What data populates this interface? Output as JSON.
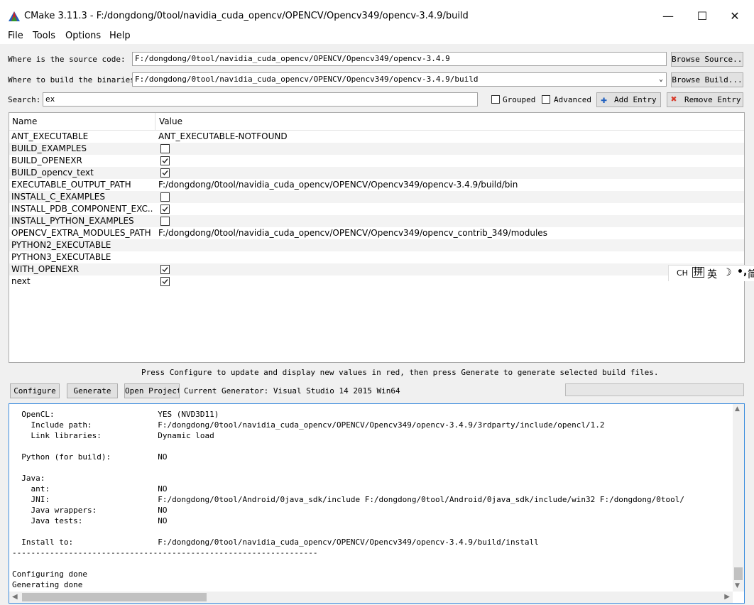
{
  "window": {
    "title": "CMake 3.11.3 - F:/dongdong/0tool/navidia_cuda_opencv/OPENCV/Opencv349/opencv-3.4.9/build",
    "minimize": "—",
    "maximize": "☐",
    "close": "✕"
  },
  "menu": [
    "File",
    "Tools",
    "Options",
    "Help"
  ],
  "source": {
    "label": "Where is the source code:",
    "value": "F:/dongdong/0tool/navidia_cuda_opencv/OPENCV/Opencv349/opencv-3.4.9",
    "button": "Browse Source..."
  },
  "binaries": {
    "label": "Where to build the binaries:",
    "value": "F:/dongdong/0tool/navidia_cuda_opencv/OPENCV/Opencv349/opencv-3.4.9/build",
    "button": "Browse Build..."
  },
  "search": {
    "label": "Search:",
    "value": "ex",
    "grouped": "Grouped",
    "advanced": "Advanced",
    "add_entry": "Add Entry",
    "remove_entry": "Remove Entry"
  },
  "table": {
    "headers": [
      "Name",
      "Value"
    ],
    "rows": [
      {
        "name": "ANT_EXECUTABLE",
        "value": "ANT_EXECUTABLE-NOTFOUND"
      },
      {
        "name": "BUILD_EXAMPLES",
        "checked": false
      },
      {
        "name": "BUILD_OPENEXR",
        "checked": true
      },
      {
        "name": "BUILD_opencv_text",
        "checked": true
      },
      {
        "name": "EXECUTABLE_OUTPUT_PATH",
        "value": "F:/dongdong/0tool/navidia_cuda_opencv/OPENCV/Opencv349/opencv-3.4.9/build/bin"
      },
      {
        "name": "INSTALL_C_EXAMPLES",
        "checked": false
      },
      {
        "name": "INSTALL_PDB_COMPONENT_EXC...",
        "checked": true
      },
      {
        "name": "INSTALL_PYTHON_EXAMPLES",
        "checked": false
      },
      {
        "name": "OPENCV_EXTRA_MODULES_PATH",
        "value": "F:/dongdong/0tool/navidia_cuda_opencv/OPENCV/Opencv349/opencv_contrib_349/modules"
      },
      {
        "name": "PYTHON2_EXECUTABLE",
        "value": ""
      },
      {
        "name": "PYTHON3_EXECUTABLE",
        "value": ""
      },
      {
        "name": "WITH_OPENEXR",
        "checked": true
      },
      {
        "name": "next",
        "checked": true
      }
    ]
  },
  "ime": {
    "ch": "CH",
    "pin": "拼",
    "ying": "英",
    "moon": "☽",
    "punct": "•,",
    "jian": "简"
  },
  "hint": "Press Configure to update and display new values in red, then press Generate to generate selected build files.",
  "actions": {
    "configure": "Configure",
    "generate": "Generate",
    "open_project": "Open Project",
    "generator": "Current Generator: Visual Studio 14 2015 Win64"
  },
  "log": [
    "  OpenCL:                      YES (NVD3D11)",
    "    Include path:              F:/dongdong/0tool/navidia_cuda_opencv/OPENCV/Opencv349/opencv-3.4.9/3rdparty/include/opencl/1.2",
    "    Link libraries:            Dynamic load",
    "",
    "  Python (for build):          NO",
    "",
    "  Java:",
    "    ant:                       NO",
    "    JNI:                       F:/dongdong/0tool/Android/0java_sdk/include F:/dongdong/0tool/Android/0java_sdk/include/win32 F:/dongdong/0tool/",
    "    Java wrappers:             NO",
    "    Java tests:                NO",
    "",
    "  Install to:                  F:/dongdong/0tool/navidia_cuda_opencv/OPENCV/Opencv349/opencv-3.4.9/build/install",
    "-----------------------------------------------------------------",
    "",
    "Configuring done",
    "Generating done"
  ]
}
